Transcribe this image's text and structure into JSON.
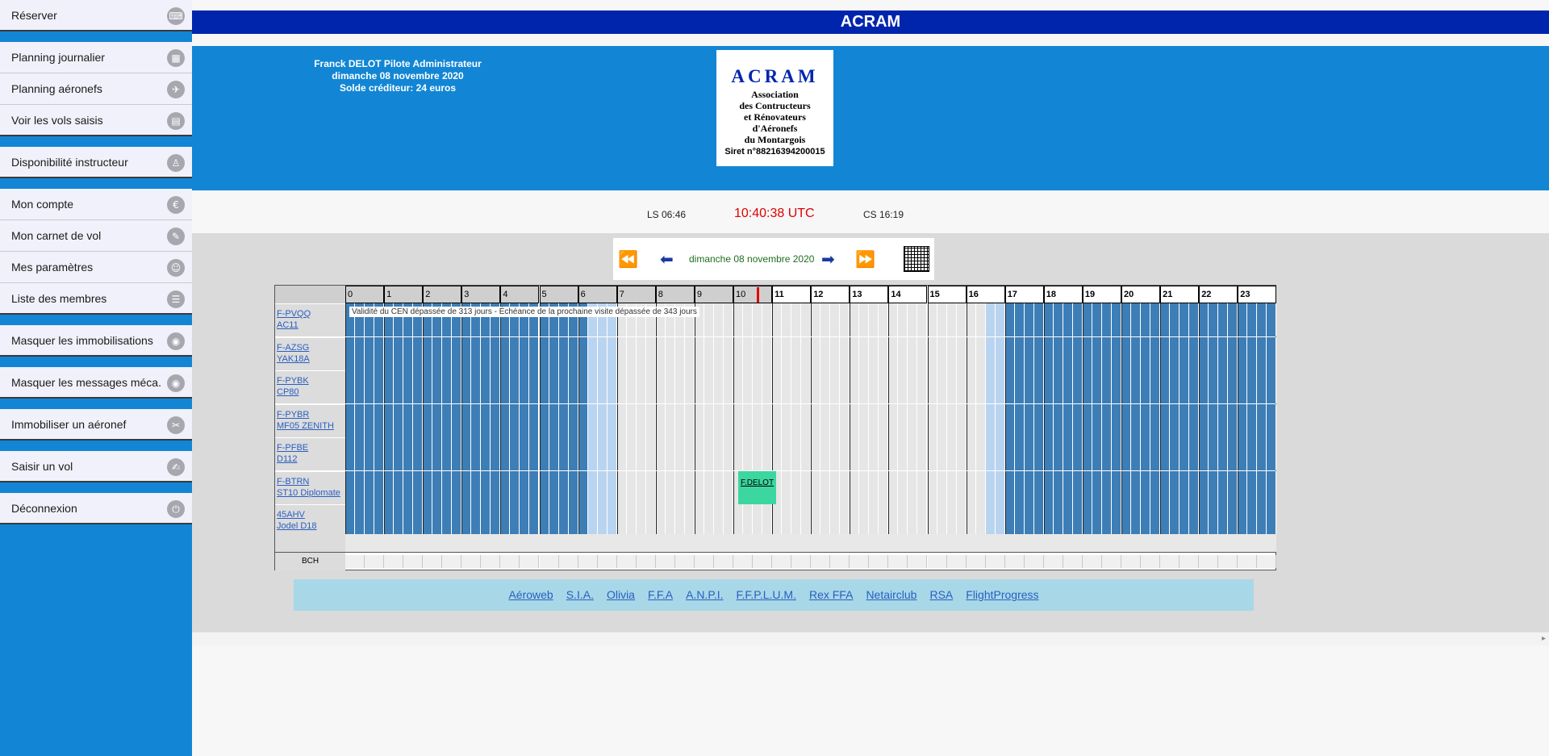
{
  "sidebar": {
    "groups": [
      [
        {
          "label": "Réserver",
          "icon": "keyboard-icon",
          "glyph": "⌨"
        }
      ],
      [
        {
          "label": "Planning journalier",
          "icon": "calendar-icon",
          "glyph": "▦"
        },
        {
          "label": "Planning aéronefs",
          "icon": "plane-icon",
          "glyph": "✈"
        },
        {
          "label": "Voir les vols saisis",
          "icon": "table-icon",
          "glyph": "▤"
        }
      ],
      [
        {
          "label": "Disponibilité instructeur",
          "icon": "person-icon",
          "glyph": "♙"
        }
      ],
      [
        {
          "label": "Mon compte",
          "icon": "euro-icon",
          "glyph": "€"
        },
        {
          "label": "Mon carnet de vol",
          "icon": "logbook-icon",
          "glyph": "✎"
        },
        {
          "label": "Mes paramètres",
          "icon": "user-icon",
          "glyph": "☺"
        },
        {
          "label": "Liste des membres",
          "icon": "list-icon",
          "glyph": "☰"
        }
      ],
      [
        {
          "label": "Masquer les immobilisations",
          "icon": "eye-icon",
          "glyph": "◉"
        }
      ],
      [
        {
          "label": "Masquer les messages méca.",
          "icon": "eye-icon",
          "glyph": "◉"
        }
      ],
      [
        {
          "label": "Immobiliser un aéronef",
          "icon": "wrench-icon",
          "glyph": "✂"
        }
      ],
      [
        {
          "label": "Saisir un vol",
          "icon": "edit-icon",
          "glyph": "✍"
        }
      ],
      [
        {
          "label": "Déconnexion",
          "icon": "power-icon",
          "glyph": "⏻"
        }
      ]
    ]
  },
  "header": {
    "title": "ACRAM",
    "user_name": "Franck DELOT Pilote Administrateur",
    "date": "dimanche 08 novembre 2020",
    "balance": "Solde créditeur: 24 euros"
  },
  "logo": {
    "brand": "ACRAM",
    "lines": [
      "Association",
      "des Contructeurs",
      "et Rénovateurs",
      "d'Aéronefs",
      "du Montargois"
    ],
    "siret": "Siret n°88216394200015"
  },
  "times": {
    "ls": "LS 06:46",
    "utc": "10:40:38 UTC",
    "cs": "CS 16:19"
  },
  "datenav": {
    "date": "dimanche 08 novembre 2020"
  },
  "schedule": {
    "hours": [
      "0",
      "1",
      "2",
      "3",
      "4",
      "5",
      "6",
      "7",
      "8",
      "9",
      "10",
      "11",
      "12",
      "13",
      "14",
      "15",
      "16",
      "17",
      "18",
      "19",
      "20",
      "21",
      "22",
      "23"
    ],
    "aircraft": [
      {
        "reg": "F-PVQQ",
        "type": "AC11"
      },
      {
        "reg": "F-AZSG",
        "type": "YAK18A"
      },
      {
        "reg": "F-PYBK",
        "type": "CP80"
      },
      {
        "reg": "F-PYBR",
        "type": "MF05 ZENITH"
      },
      {
        "reg": "F-PFBE",
        "type": "D112"
      },
      {
        "reg": "F-BTRN",
        "type": "ST10 Diplomate"
      },
      {
        "reg": "45AHV",
        "type": "Jodel D18"
      }
    ],
    "alert": "Validité du CEN dépassée de 313 jours - Échéance de la prochaine visite dépassée de 343 jours",
    "booking": "F.DELOT",
    "bch_label": "BCH"
  },
  "footer_links": [
    "Aéroweb",
    "S.I.A.",
    "Olivia",
    "F.F.A",
    "A.N.P.I.",
    "F.F.P.L.U.M.",
    "Rex FFA",
    "Netairclub",
    "RSA",
    "FlightProgress"
  ],
  "colors": {
    "sidebar": "#1286d4",
    "titlebar": "#0025ad",
    "night": "#3d7eb6",
    "twilight": "#b9d4f0",
    "booking": "#3cd7a0",
    "utc": "#e00000"
  }
}
